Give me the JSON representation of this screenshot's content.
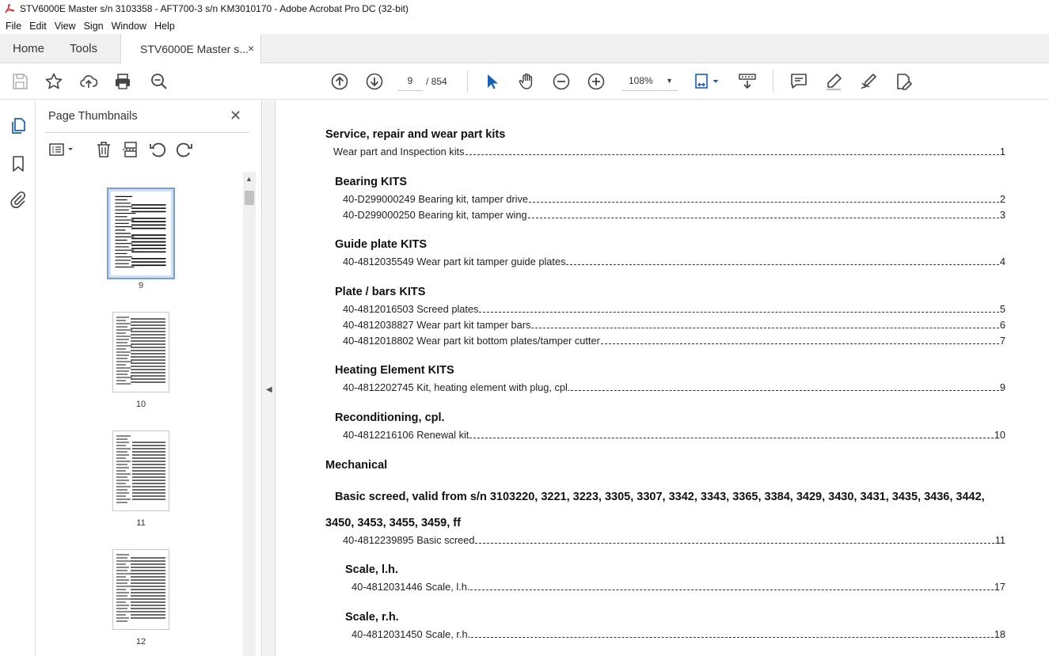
{
  "window": {
    "title": "STV6000E Master s/n 3103358 - AFT700-3 s/n KM3010170 - Adobe Acrobat Pro DC (32-bit)"
  },
  "menu": [
    "File",
    "Edit",
    "View",
    "Sign",
    "Window",
    "Help"
  ],
  "tabs": {
    "home": "Home",
    "tools": "Tools",
    "document": "STV6000E Master s...",
    "close": "×"
  },
  "toolbar": {
    "page_current": "9",
    "page_total": "/ 854",
    "zoom": "108%"
  },
  "thumbnails": {
    "title": "Page Thumbnails",
    "close": "✕",
    "pages": [
      {
        "label": "9",
        "selected": true
      },
      {
        "label": "10",
        "selected": false
      },
      {
        "label": "11",
        "selected": false
      },
      {
        "label": "12",
        "selected": false
      }
    ]
  },
  "document": {
    "entries": [
      {
        "kind": "h",
        "text": "Service, repair and wear part kits"
      },
      {
        "kind": "l",
        "text": "Wear part and Inspection kits",
        "page": "1"
      },
      {
        "kind": "h",
        "text": "Bearing KITS"
      },
      {
        "kind": "l",
        "text": "40-D299000249 Bearing kit, tamper drive",
        "page": "2"
      },
      {
        "kind": "l",
        "text": "40-D299000250 Bearing kit, tamper wing",
        "page": "3"
      },
      {
        "kind": "h",
        "text": "Guide plate KITS"
      },
      {
        "kind": "l",
        "text": "40-4812035549 Wear part kit tamper guide plates",
        "page": "4"
      },
      {
        "kind": "h",
        "text": "Plate / bars KITS"
      },
      {
        "kind": "l",
        "text": "40-4812016503 Screed plates",
        "page": "5"
      },
      {
        "kind": "l",
        "text": "40-4812038827 Wear part kit tamper bars",
        "page": "6"
      },
      {
        "kind": "l",
        "text": "40-4812018802 Wear part kit bottom plates/tamper cutter",
        "page": "7"
      },
      {
        "kind": "h",
        "text": "Heating Element KITS"
      },
      {
        "kind": "l",
        "text": "40-4812202745 Kit, heating element with plug, cpl.",
        "page": "9"
      },
      {
        "kind": "h",
        "text": "Reconditioning, cpl."
      },
      {
        "kind": "l",
        "text": "40-4812216106 Renewal kit",
        "page": "10"
      },
      {
        "kind": "h",
        "text": "Mechanical"
      },
      {
        "kind": "h",
        "text": "Basic screed, valid from s/n 3103220, 3221, 3223, 3305, 3307, 3342, 3343, 3365, 3384, 3429, 3430, 3431, 3435, 3436, 3442,"
      },
      {
        "kind": "h",
        "text": "3450, 3453, 3455, 3459, ff"
      },
      {
        "kind": "l",
        "text": "40-4812239895 Basic screed",
        "page": "11"
      },
      {
        "kind": "h",
        "text": "Scale, l.h."
      },
      {
        "kind": "l",
        "text": "40-4812031446 Scale, l.h.",
        "page": "17"
      },
      {
        "kind": "h",
        "text": "Scale, r.h."
      },
      {
        "kind": "l",
        "text": "40-4812031450 Scale, r.h.",
        "page": "18"
      }
    ]
  }
}
